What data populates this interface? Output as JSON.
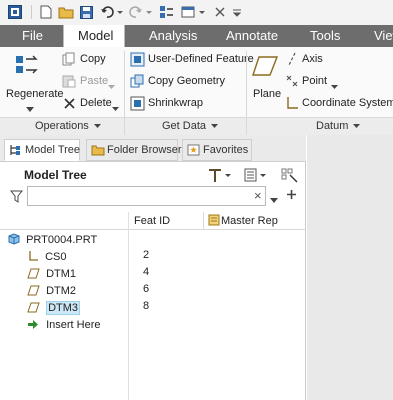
{
  "ribbon_tabs": [
    "File",
    "Model",
    "Analysis",
    "Annotate",
    "Tools",
    "View"
  ],
  "active_tab": "Model",
  "ribbon": {
    "operations": {
      "regenerate": "Regenerate",
      "copy": "Copy",
      "paste": "Paste",
      "delete": "Delete",
      "group_title": "Operations"
    },
    "get_data": {
      "user_defined_feature": "User-Defined Feature",
      "copy_geometry": "Copy Geometry",
      "shrinkwrap": "Shrinkwrap",
      "group_title": "Get Data"
    },
    "datum": {
      "plane": "Plane",
      "axis": "Axis",
      "point": "Point",
      "coordinate_system": "Coordinate System",
      "group_title": "Datum"
    }
  },
  "panel": {
    "tabs": [
      "Model Tree",
      "Folder Browser",
      "Favorites"
    ],
    "active_tab": "Model Tree",
    "header_title": "Model Tree",
    "search": {
      "value": "",
      "clear_symbol": "×"
    },
    "columns": [
      "Feat ID",
      "Master Rep"
    ],
    "tree": {
      "root": "PRT0004.PRT",
      "items": [
        {
          "name": "CS0",
          "feat_id": "2",
          "icon": "coordinate-system-icon",
          "selected": false
        },
        {
          "name": "DTM1",
          "feat_id": "4",
          "icon": "datum-plane-icon",
          "selected": false
        },
        {
          "name": "DTM2",
          "feat_id": "6",
          "icon": "datum-plane-icon",
          "selected": false
        },
        {
          "name": "DTM3",
          "feat_id": "8",
          "icon": "datum-plane-icon",
          "selected": true
        }
      ],
      "insert_here": "Insert Here"
    }
  },
  "colors": {
    "tabbar": "#6d6d6d",
    "selection": "#cce8f6",
    "insert_arrow": "#2e8b2e",
    "accent_blue": "#2a6fb0"
  }
}
